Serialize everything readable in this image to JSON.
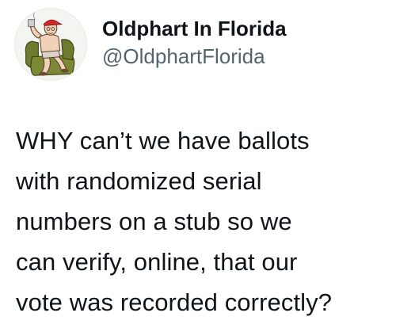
{
  "tweet": {
    "author": {
      "display_name": "Oldphart In Florida",
      "handle": "@OldphartFlorida",
      "avatar_icon": "cartoon-old-man-in-armchair-avatar"
    },
    "text_lines": [
      "WHY can’t we have ballots",
      "with randomized serial",
      "numbers on a stub so we",
      "can verify, online, that our",
      "vote was recorded correctly?"
    ]
  },
  "colors": {
    "text_primary": "#0f1419",
    "text_secondary": "#536471",
    "background": "#ffffff"
  }
}
